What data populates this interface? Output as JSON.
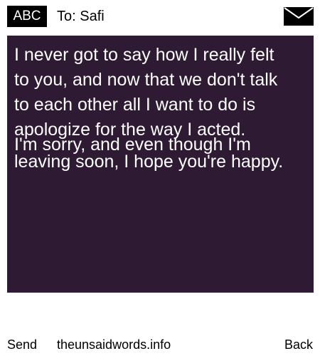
{
  "header": {
    "badge_label": "ABC",
    "to_label": "To: Safi",
    "envelope_icon": "envelope-icon"
  },
  "message": {
    "lines": [
      "I never got to say how I really felt",
      "to you, and now that we don't talk",
      "to each other all I want to do is",
      "apologize for the way I acted."
    ],
    "overlap_lines": [
      "I'm sorry, and even though I'm",
      "leaving soon, I hope you're happy."
    ],
    "background_color": "#2f1a33",
    "text_color": "#ffffff"
  },
  "footer": {
    "send_label": "Send",
    "site_label": "theunsaidwords.info",
    "back_label": "Back"
  }
}
